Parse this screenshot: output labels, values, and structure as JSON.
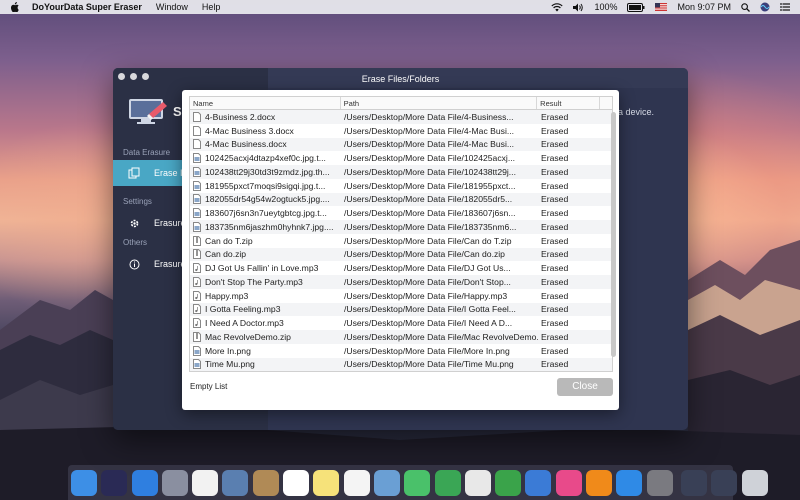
{
  "menubar": {
    "app_name": "DoYourData Super Eraser",
    "menus": [
      "Window",
      "Help"
    ],
    "battery": "100%",
    "clock": "Mon 9:07 PM"
  },
  "window": {
    "app_name_partial": "S",
    "header_title": "Erase Files/Folders",
    "tip_partial": "a device.",
    "sidebar": {
      "section_data_erasure": "Data Erasure",
      "item_erase": "Erase I",
      "section_settings": "Settings",
      "item_erasure_settings": "Erasure",
      "section_others": "Others",
      "item_erasure_others": "Erasure"
    }
  },
  "dialog": {
    "columns": {
      "name": "Name",
      "path": "Path",
      "result": "Result"
    },
    "rows": [
      {
        "name": "4-Business 2.docx",
        "path": "/Users/Desktop/More Data File/4-Business...",
        "result": "Erased",
        "icon": "doc-icon"
      },
      {
        "name": "4-Mac Business 3.docx",
        "path": "/Users/Desktop/More Data File/4-Mac Busi...",
        "result": "Erased",
        "icon": "doc-icon"
      },
      {
        "name": "4-Mac Business.docx",
        "path": "/Users/Desktop/More Data File/4-Mac Busi...",
        "result": "Erased",
        "icon": "doc-icon"
      },
      {
        "name": "102425acxj4dtazp4xef0c.jpg.t...",
        "path": "/Users/Desktop/More Data File/102425acxj...",
        "result": "Erased",
        "icon": "image-icon"
      },
      {
        "name": "102438tt29j30td3t9zmdz.jpg.th...",
        "path": "/Users/Desktop/More Data File/102438tt29j...",
        "result": "Erased",
        "icon": "image-icon"
      },
      {
        "name": "181955pxct7moqsi9sigqi.jpg.t...",
        "path": "/Users/Desktop/More Data File/181955pxct...",
        "result": "Erased",
        "icon": "image-icon"
      },
      {
        "name": "182055dr54g54w2ogtuck5.jpg....",
        "path": "/Users/Desktop/More Data File/182055dr5...",
        "result": "Erased",
        "icon": "image-icon"
      },
      {
        "name": "183607j6sn3n7ueytgbtcg.jpg.t...",
        "path": "/Users/Desktop/More Data File/183607j6sn...",
        "result": "Erased",
        "icon": "image-icon"
      },
      {
        "name": "183735nm6jaszhm0hyhnk7.jpg....",
        "path": "/Users/Desktop/More Data File/183735nm6...",
        "result": "Erased",
        "icon": "image-icon"
      },
      {
        "name": "Can do T.zip",
        "path": "/Users/Desktop/More Data File/Can do T.zip",
        "result": "Erased",
        "icon": "zip-icon"
      },
      {
        "name": "Can do.zip",
        "path": "/Users/Desktop/More Data File/Can do.zip",
        "result": "Erased",
        "icon": "zip-icon"
      },
      {
        "name": "DJ Got Us Fallin' in Love.mp3",
        "path": "/Users/Desktop/More Data File/DJ Got Us...",
        "result": "Erased",
        "icon": "audio-icon"
      },
      {
        "name": "Don't Stop The Party.mp3",
        "path": "/Users/Desktop/More Data File/Don't Stop...",
        "result": "Erased",
        "icon": "audio-icon"
      },
      {
        "name": "Happy.mp3",
        "path": "/Users/Desktop/More Data File/Happy.mp3",
        "result": "Erased",
        "icon": "audio-icon"
      },
      {
        "name": "I Gotta Feeling.mp3",
        "path": "/Users/Desktop/More Data File/I Gotta Feel...",
        "result": "Erased",
        "icon": "audio-icon"
      },
      {
        "name": "I Need A Doctor.mp3",
        "path": "/Users/Desktop/More Data File/I Need A D...",
        "result": "Erased",
        "icon": "audio-icon"
      },
      {
        "name": "Mac RevolveDemo.zip",
        "path": "/Users/Desktop/More Data File/Mac RevolveDemo.zip",
        "result": "Erased",
        "icon": "zip-icon"
      },
      {
        "name": "More In.png",
        "path": "/Users/Desktop/More Data File/More In.png",
        "result": "Erased",
        "icon": "image-icon"
      },
      {
        "name": "Time Mu.png",
        "path": "/Users/Desktop/More Data File/Time Mu.png",
        "result": "Erased",
        "icon": "image-icon"
      }
    ],
    "empty_list_label": "Empty List",
    "close_label": "Close"
  },
  "dock": {
    "apps": [
      {
        "name": "finder-icon",
        "color": "#3d8fe6"
      },
      {
        "name": "siri-icon",
        "color": "#2a2a55"
      },
      {
        "name": "safari-icon",
        "color": "#2f7fe0"
      },
      {
        "name": "launchpad-icon",
        "color": "#8a8fa0"
      },
      {
        "name": "photos-icon",
        "color": "#f2f2f2"
      },
      {
        "name": "image-capture-icon",
        "color": "#5a7fb0"
      },
      {
        "name": "contacts-icon",
        "color": "#b08a56"
      },
      {
        "name": "calendar-icon",
        "color": "#ffffff"
      },
      {
        "name": "notes-icon",
        "color": "#f6e27a"
      },
      {
        "name": "reminders-icon",
        "color": "#f4f4f4"
      },
      {
        "name": "preview-icon",
        "color": "#6a9fd4"
      },
      {
        "name": "messages-icon",
        "color": "#4ac16a"
      },
      {
        "name": "facetime-icon",
        "color": "#3aa655"
      },
      {
        "name": "textedit-icon",
        "color": "#e8e8e8"
      },
      {
        "name": "numbers-icon",
        "color": "#3aa34a"
      },
      {
        "name": "keynote-icon",
        "color": "#3b7bd6"
      },
      {
        "name": "itunes-icon",
        "color": "#e84a8a"
      },
      {
        "name": "ibooks-icon",
        "color": "#f08a1a"
      },
      {
        "name": "app-store-icon",
        "color": "#2f8ae6"
      },
      {
        "name": "system-preferences-icon",
        "color": "#7a7a80"
      },
      {
        "name": "super-eraser-icon",
        "color": "#394056"
      },
      {
        "name": "super-eraser-alt-icon",
        "color": "#394056"
      },
      {
        "name": "trash-icon",
        "color": "#cfd2d8"
      }
    ]
  }
}
